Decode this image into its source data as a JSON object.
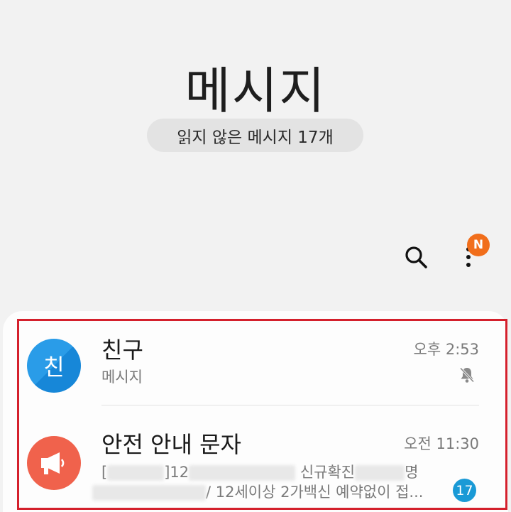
{
  "header": {
    "title": "메시지",
    "unread_summary": "읽지 않은 메시지 17개",
    "menu_badge": "N"
  },
  "conversations": [
    {
      "name": "친구",
      "avatar_letter": "친",
      "preview": "메시지",
      "time": "오후 2:53",
      "muted": true
    },
    {
      "name": "안전 안내 문자",
      "preview_line1_a": "[",
      "preview_line1_b": "]12",
      "preview_line1_c": "신규확진",
      "preview_line1_d": "명",
      "preview_line2_a": "/",
      "preview_line2_b": "12세이상 2가백신 예약없이 접...",
      "time": "오전 11:30",
      "unread_count": "17"
    }
  ],
  "colors": {
    "friend_avatar": "#2a9ce8",
    "alert_avatar": "#f0624c",
    "badge_orange": "#f16e1b",
    "count_badge": "#1a9ad6",
    "highlight_border": "#d4202c"
  }
}
